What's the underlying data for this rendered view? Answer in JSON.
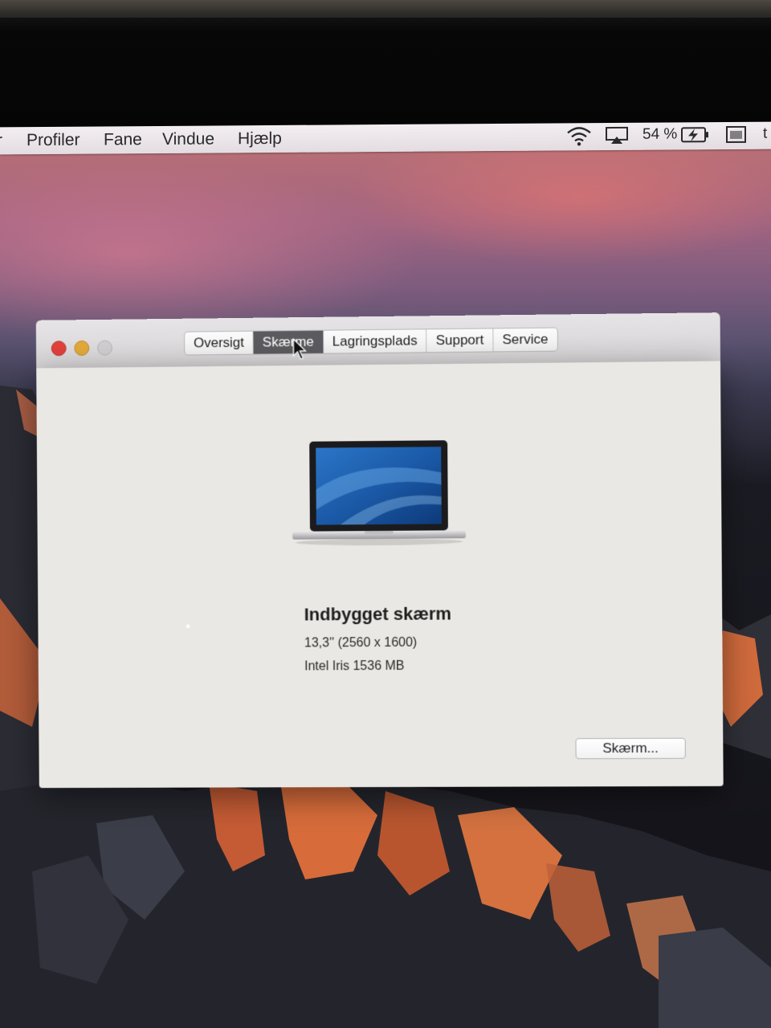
{
  "menubar": {
    "items": [
      "Profiler",
      "Fane",
      "Vindue",
      "Hjælp"
    ],
    "battery_percent": "54 %"
  },
  "window": {
    "tabs": [
      "Oversigt",
      "Skærme",
      "Lagringsplads",
      "Support",
      "Service"
    ],
    "selected_tab": "Skærme"
  },
  "display": {
    "name": "Indbygget skærm",
    "resolution": "13,3'' (2560 x 1600)",
    "graphics": "Intel Iris 1536 MB",
    "button_label": "Skærm..."
  },
  "colors": {
    "close": "#e0413b",
    "minimize": "#e2a83a",
    "zoom": "#cfcdce",
    "selected_tab": "#5b5b5f"
  }
}
